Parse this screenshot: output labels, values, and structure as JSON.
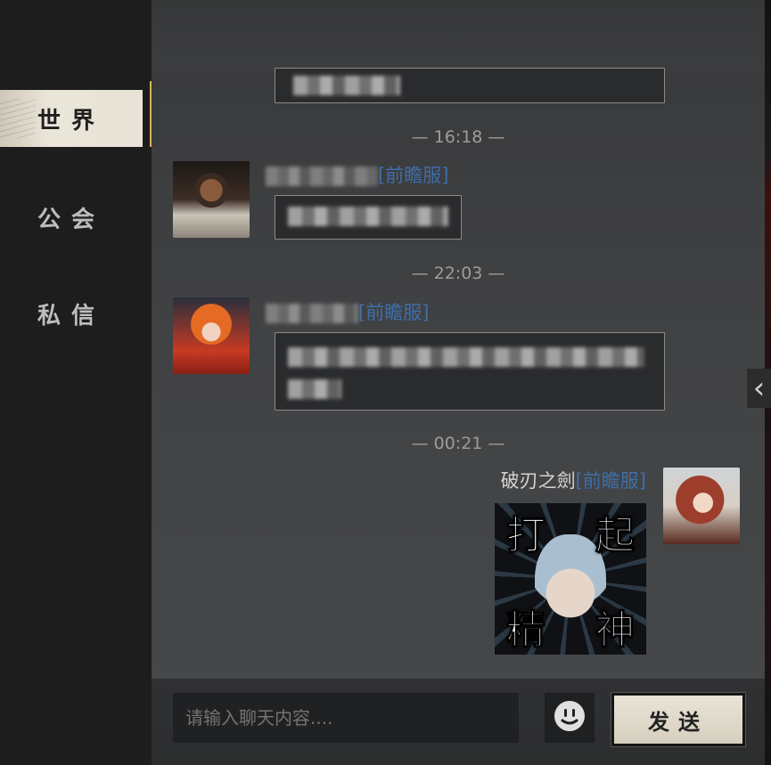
{
  "sidebar": {
    "tabs": [
      {
        "label": "世界",
        "active": true
      },
      {
        "label": "公会",
        "active": false
      },
      {
        "label": "私信",
        "active": false
      }
    ],
    "active_accent": "#d7b350"
  },
  "chat": {
    "timestamps": [
      "16:18",
      "22:03",
      "00:21"
    ],
    "messages": [
      {
        "server": "[前瞻服]",
        "sender_blurred": true
      },
      {
        "server": "[前瞻服]",
        "sender_blurred": true
      },
      {
        "sender": "破刃之劍",
        "server": "[前瞻服]",
        "sticker_text": [
          "打",
          "起",
          "精",
          "神"
        ]
      }
    ]
  },
  "input": {
    "placeholder": "请输入聊天内容....",
    "value": ""
  },
  "buttons": {
    "send_label": "发送",
    "emoji_icon": "smiley-face-icon",
    "collapse_icon": "chevron-left-icon"
  },
  "colors": {
    "server_tag": "#3e6fa8",
    "panel_bg": "#414244",
    "sidebar_bg": "#1d1d1e"
  }
}
